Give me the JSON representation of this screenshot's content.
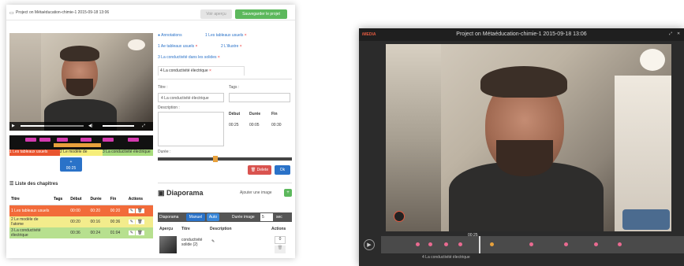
{
  "editor": {
    "title": "Project on Métaéducation-chimie-1 2015-09-18 13:06",
    "preview_label": "Voir aperçu",
    "save_label": "Sauvegarder le projet",
    "annotation_tabs": [
      "Annotations",
      "1 Les tableaux usuels",
      "1 Ae tableaux usuels",
      "2 L'illustre",
      "3 La conductivité dans les solides",
      "4 La conductivité électrique"
    ],
    "form": {
      "title_label": "Titre :",
      "title_value": "4 La conductivité électrique",
      "tags_label": "Tags :",
      "description_label": "Description :",
      "debut_label": "Début",
      "duree_label": "Durée",
      "fin_label": "Fin",
      "debut_value": "00:25",
      "duree_value": "00:05",
      "fin_value": "00:30",
      "duree_slider_label": "Durée :",
      "delete_label": "Delete",
      "ok_label": "Ok"
    },
    "timeline_labels": [
      "1 Les tableaux usuels",
      "2 Le modèle de",
      "3 La conductivité électrique"
    ],
    "new_chapter": "00:25",
    "chapters": {
      "heading": "Liste des chapitres",
      "columns": [
        "Titre",
        "Tags",
        "Début",
        "Durée",
        "Fin",
        "Actions"
      ],
      "rows": [
        {
          "title": "1 Les tableaux usuels",
          "debut": "00:00",
          "duree": "00:20",
          "fin": "00:20",
          "color": "#f26b3a"
        },
        {
          "title": "2 Le modèle de l'atome",
          "debut": "00:20",
          "duree": "00:16",
          "fin": "00:36",
          "color": "#f3ec8c"
        },
        {
          "title": "3 La conductivité électrique",
          "debut": "00:36",
          "duree": "00:24",
          "fin": "01:04",
          "color": "#b7e08f"
        }
      ]
    },
    "diaporama": {
      "heading": "Diaporama",
      "add_label": "Ajouter une image",
      "tab_label": "Diaporama",
      "mode_manual": "Manuel",
      "mode_auto": "Auto",
      "duration_label": "Durée image",
      "duration_value": "5",
      "duration_unit": "sec",
      "columns": [
        "Aperçu",
        "Titre",
        "Description",
        "Actions"
      ],
      "item_title": "conductivité solide (2)",
      "item_order": "0"
    }
  },
  "player": {
    "brand": "iMEDIA",
    "title": "Project on Métaéducation-chimie-1 2015-09-18 13:06",
    "current_marker": "00:25",
    "chapter_tooltip": "4 La conductivité électrique",
    "accent": "#e05a40"
  }
}
